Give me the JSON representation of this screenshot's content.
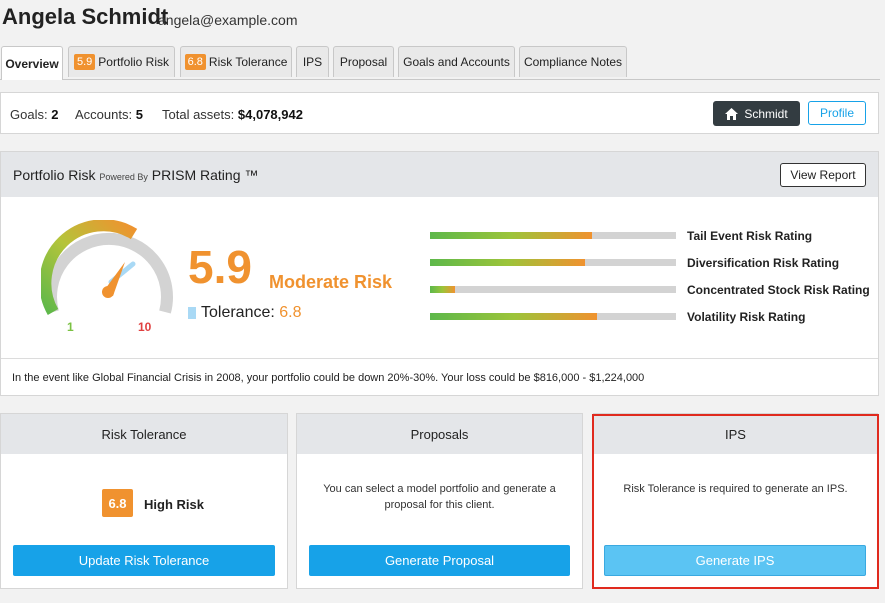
{
  "client": {
    "name": "Angela Schmidt",
    "email": "angela@example.com"
  },
  "tabs": [
    {
      "label": "Overview"
    },
    {
      "badge": "5.9",
      "label": "Portfolio Risk"
    },
    {
      "badge": "6.8",
      "label": "Risk Tolerance"
    },
    {
      "label": "IPS"
    },
    {
      "label": "Proposal"
    },
    {
      "label": "Goals and Accounts"
    },
    {
      "label": "Compliance Notes"
    }
  ],
  "summary": {
    "goals_label": "Goals:",
    "goals": "2",
    "accounts_label": "Accounts:",
    "accounts": "5",
    "assets_label": "Total assets:",
    "assets": "$4,078,942",
    "household_button": "Schmidt",
    "profile_button": "Profile"
  },
  "portfolio_risk": {
    "title": "Portfolio Risk",
    "powered_by": "Powered By",
    "brand": "PRISM Rating ™",
    "view_report": "View Report",
    "gauge_min": "1",
    "gauge_max": "10",
    "score": "5.9",
    "score_label": "Moderate Risk",
    "tolerance_label": "Tolerance:",
    "tolerance_value": "6.8",
    "ratings": [
      {
        "label": "Tail Event Risk Rating",
        "level": 0.66
      },
      {
        "label": "Diversification Risk Rating",
        "level": 0.63
      },
      {
        "label": "Concentrated Stock Risk Rating",
        "level": 0.1
      },
      {
        "label": "Volatility Risk Rating",
        "level": 0.68
      }
    ],
    "note": "In the event like Global Financial Crisis in 2008, your portfolio could be down 20%-30%. Your loss could be $816,000 - $1,224,000"
  },
  "cards": {
    "risk_tolerance": {
      "title": "Risk Tolerance",
      "badge": "6.8",
      "label": "High Risk",
      "button": "Update Risk Tolerance"
    },
    "proposals": {
      "title": "Proposals",
      "text": "You can select a model portfolio and generate a proposal for this client.",
      "button": "Generate Proposal"
    },
    "ips": {
      "title": "IPS",
      "text": "Risk Tolerance is required to generate an IPS.",
      "button": "Generate IPS"
    }
  },
  "colors": {
    "accent": "#17a2e8",
    "orange": "#f0922f",
    "disabled_button": "#5bc4f3",
    "highlight": "#e02a1e"
  }
}
